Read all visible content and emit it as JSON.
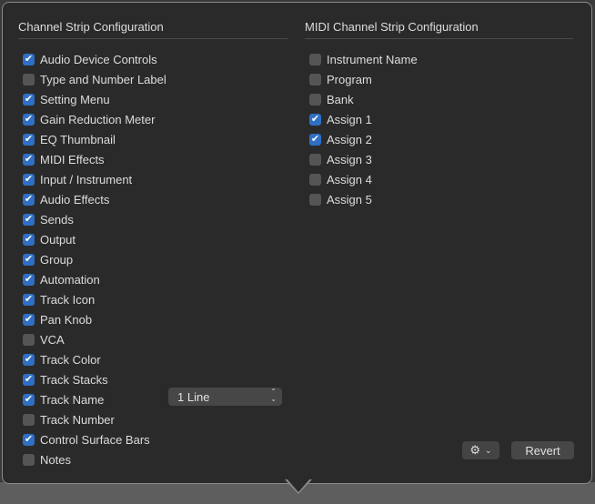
{
  "channel_strip": {
    "title": "Channel Strip Configuration",
    "items": [
      {
        "label": "Audio Device Controls",
        "checked": true
      },
      {
        "label": "Type and Number Label",
        "checked": false
      },
      {
        "label": "Setting Menu",
        "checked": true
      },
      {
        "label": "Gain Reduction Meter",
        "checked": true
      },
      {
        "label": "EQ Thumbnail",
        "checked": true
      },
      {
        "label": "MIDI Effects",
        "checked": true
      },
      {
        "label": "Input / Instrument",
        "checked": true
      },
      {
        "label": "Audio Effects",
        "checked": true
      },
      {
        "label": "Sends",
        "checked": true
      },
      {
        "label": "Output",
        "checked": true
      },
      {
        "label": "Group",
        "checked": true
      },
      {
        "label": "Automation",
        "checked": true
      },
      {
        "label": "Track Icon",
        "checked": true
      },
      {
        "label": "Pan Knob",
        "checked": true
      },
      {
        "label": "VCA",
        "checked": false
      },
      {
        "label": "Track Color",
        "checked": true
      },
      {
        "label": "Track Stacks",
        "checked": true
      },
      {
        "label": "Track Name",
        "checked": true
      },
      {
        "label": "Track Number",
        "checked": false
      },
      {
        "label": "Control Surface Bars",
        "checked": true
      },
      {
        "label": "Notes",
        "checked": false
      }
    ],
    "track_name_select": "1 Line"
  },
  "midi_strip": {
    "title": "MIDI Channel Strip Configuration",
    "items": [
      {
        "label": "Instrument Name",
        "checked": false
      },
      {
        "label": "Program",
        "checked": false
      },
      {
        "label": "Bank",
        "checked": false
      },
      {
        "label": "Assign 1",
        "checked": true
      },
      {
        "label": "Assign 2",
        "checked": true
      },
      {
        "label": "Assign 3",
        "checked": false
      },
      {
        "label": "Assign 4",
        "checked": false
      },
      {
        "label": "Assign 5",
        "checked": false
      }
    ]
  },
  "footer": {
    "revert_label": "Revert",
    "gear_icon": "gear-icon"
  },
  "colors": {
    "accent": "#2f6fc4",
    "background": "#2a2a2a"
  }
}
